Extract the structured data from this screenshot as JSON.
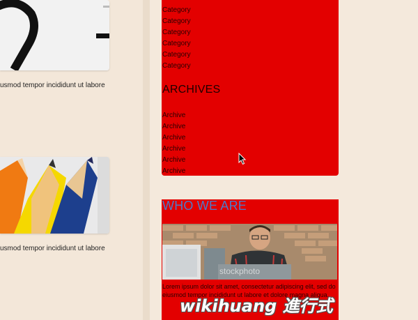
{
  "left": {
    "excerpt1": "usmod tempor incididunt ut labore",
    "excerpt2": "usmod tempor incididunt ut labore"
  },
  "categories": [
    "Category",
    "Category",
    "Category",
    "Category",
    "Category",
    "Category"
  ],
  "archives": {
    "title": "ARCHIVES",
    "items": [
      "Archive",
      "Archive",
      "Archive",
      "Archive",
      "Archive",
      "Archive"
    ]
  },
  "who": {
    "title": "WHO WE ARE",
    "photo_watermark": "stockphoto",
    "text": "Lorem ipsum dolor sit amet, consectetur adipiscing elit, sed do eiusmod tempor incididunt ut labore et dolore magna aliqua."
  },
  "overlay_watermark": "wikihuang 進行式",
  "colors": {
    "panel_red": "#e30000",
    "who_heading_blue": "#4f79c8",
    "page_bg": "#f2e6d8"
  }
}
